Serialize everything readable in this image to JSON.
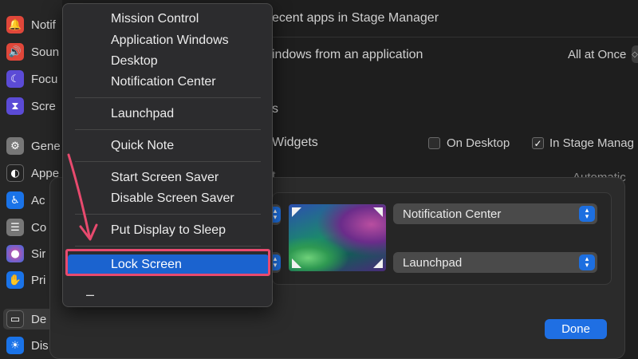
{
  "sidebar": {
    "items": [
      {
        "label": "Notif",
        "icon": "bell-icon",
        "color": "#e0473a"
      },
      {
        "label": "Soun",
        "icon": "speaker-icon",
        "color": "#e0473a"
      },
      {
        "label": "Focu",
        "icon": "moon-icon",
        "color": "#5b4bd6"
      },
      {
        "label": "Scre",
        "icon": "hourglass-icon",
        "color": "#5b4bd6"
      },
      {
        "label": "Gene",
        "icon": "gear-icon",
        "color": "#777777"
      },
      {
        "label": "Appe",
        "icon": "appearance-icon",
        "color": "#222222"
      },
      {
        "label": "Ac",
        "icon": "accessibility-icon",
        "color": "#1a73e8"
      },
      {
        "label": "Co",
        "icon": "control-center-icon",
        "color": "#777777"
      },
      {
        "label": "Sir",
        "icon": "siri-icon",
        "color": "#7a3fb8"
      },
      {
        "label": "Pri",
        "icon": "hand-icon",
        "color": "#1a73e8"
      },
      {
        "label": "De",
        "icon": "dock-icon",
        "color": "#333333"
      },
      {
        "label": "Dis",
        "icon": "display-icon",
        "color": "#1a73e8"
      }
    ]
  },
  "main": {
    "row1": "ecent apps in Stage Manager",
    "row2": "indows from an application",
    "row2_value": "All at Once",
    "section_fragment": "s",
    "widgets_label": "Widgets",
    "on_desktop": "On Desktop",
    "in_stage_manager": "In Stage Manag",
    "partial_right": "Automatic",
    "partial_char": "t"
  },
  "hot_corners": {
    "top_right": "Notification Center",
    "bottom_right": "Launchpad",
    "done_label": "Done"
  },
  "menu": {
    "items": [
      "Mission Control",
      "Application Windows",
      "Desktop",
      "Notification Center",
      "Launchpad",
      "Quick Note",
      "Start Screen Saver",
      "Disable Screen Saver",
      "Put Display to Sleep",
      "Lock Screen"
    ],
    "dash": "–",
    "accent": "#1b63cf",
    "annotation_color": "#e84a6e"
  }
}
